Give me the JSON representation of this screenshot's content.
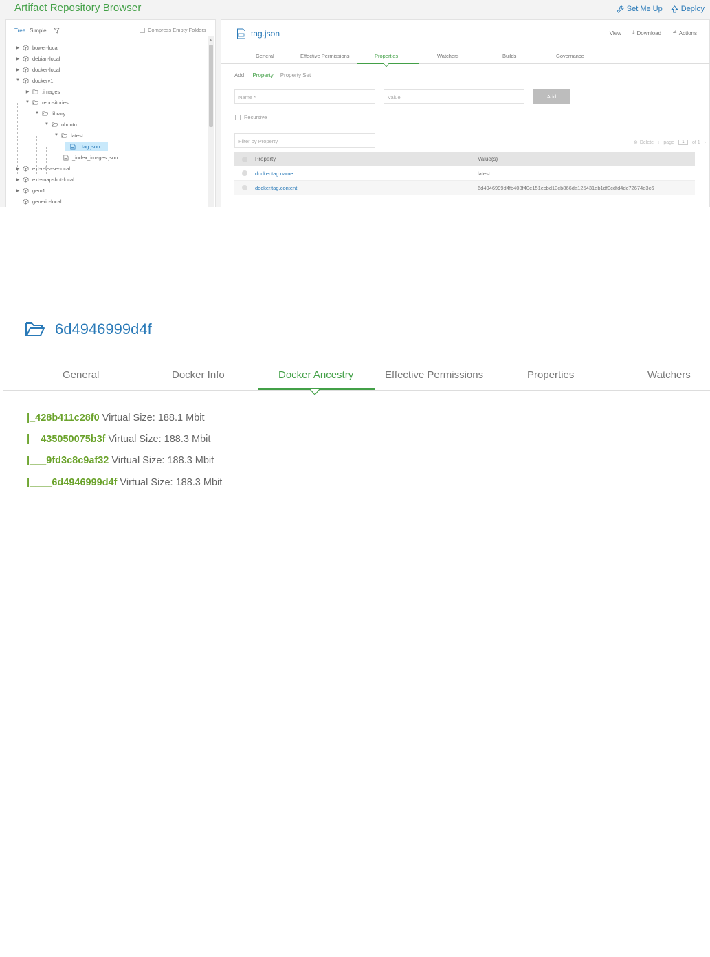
{
  "app": {
    "title": "Artifact Repository Browser",
    "set_me_up": "Set Me Up",
    "deploy": "Deploy"
  },
  "tree": {
    "tabs": [
      "Tree",
      "Simple"
    ],
    "compress_label": "Compress Empty Folders",
    "nodes": [
      {
        "label": "bower-local"
      },
      {
        "label": "debian-local"
      },
      {
        "label": "docker-local"
      },
      {
        "label": "dockerv1"
      },
      {
        "label": ".images"
      },
      {
        "label": "repositories"
      },
      {
        "label": "library"
      },
      {
        "label": "ubuntu"
      },
      {
        "label": "latest"
      },
      {
        "label": "tag.json"
      },
      {
        "label": "_index_images.json"
      },
      {
        "label": "ext-release-local"
      },
      {
        "label": "ext-snapshot-local"
      },
      {
        "label": "gem1"
      },
      {
        "label": "generic-local"
      }
    ]
  },
  "file": {
    "name": "tag.json",
    "actions": [
      "View",
      "Download",
      "Actions"
    ],
    "tabs": [
      "General",
      "Effective Permissions",
      "Properties",
      "Watchers",
      "Builds",
      "Governance"
    ],
    "active_tab": "Properties",
    "add_label": "Add:",
    "add_options": [
      "Property",
      "Property Set"
    ],
    "name_placeholder": "Name *",
    "value_placeholder": "Value",
    "add_button": "Add",
    "recursive_label": "Recursive",
    "filter_placeholder": "Filter by Property",
    "delete_label": "Delete",
    "pager": {
      "prefix": "page",
      "current": "1",
      "suffix": "of 1"
    },
    "table": {
      "headers": [
        "Property",
        "Value(s)"
      ],
      "rows": [
        {
          "property": "docker.tag.name",
          "value": "latest"
        },
        {
          "property": "docker.tag.content",
          "value": "6d4946999d4fb403f40e151ecbd13cb866da125431eb1df0cdfd4dc72674e3c6"
        }
      ]
    }
  },
  "folder": {
    "name": "6d4946999d4f",
    "tabs": [
      "General",
      "Docker Info",
      "Docker Ancestry",
      "Effective Permissions",
      "Properties",
      "Watchers"
    ],
    "active_tab": "Docker Ancestry",
    "ancestry": [
      {
        "prefix": "|_",
        "id": "428b411c28f0",
        "size": "Virtual Size: 188.1 Mbit"
      },
      {
        "prefix": "|__",
        "id": "435050075b3f",
        "size": "Virtual Size: 188.3 Mbit"
      },
      {
        "prefix": "|___",
        "id": "9fd3c8c9af32",
        "size": "Virtual Size: 188.3 Mbit"
      },
      {
        "prefix": "|____",
        "id": "6d4946999d4f",
        "size": "Virtual Size: 188.3 Mbit"
      }
    ]
  },
  "colors": {
    "accent_green": "#43a047",
    "link_blue": "#2a7ab8",
    "id_green": "#6ba32c"
  }
}
